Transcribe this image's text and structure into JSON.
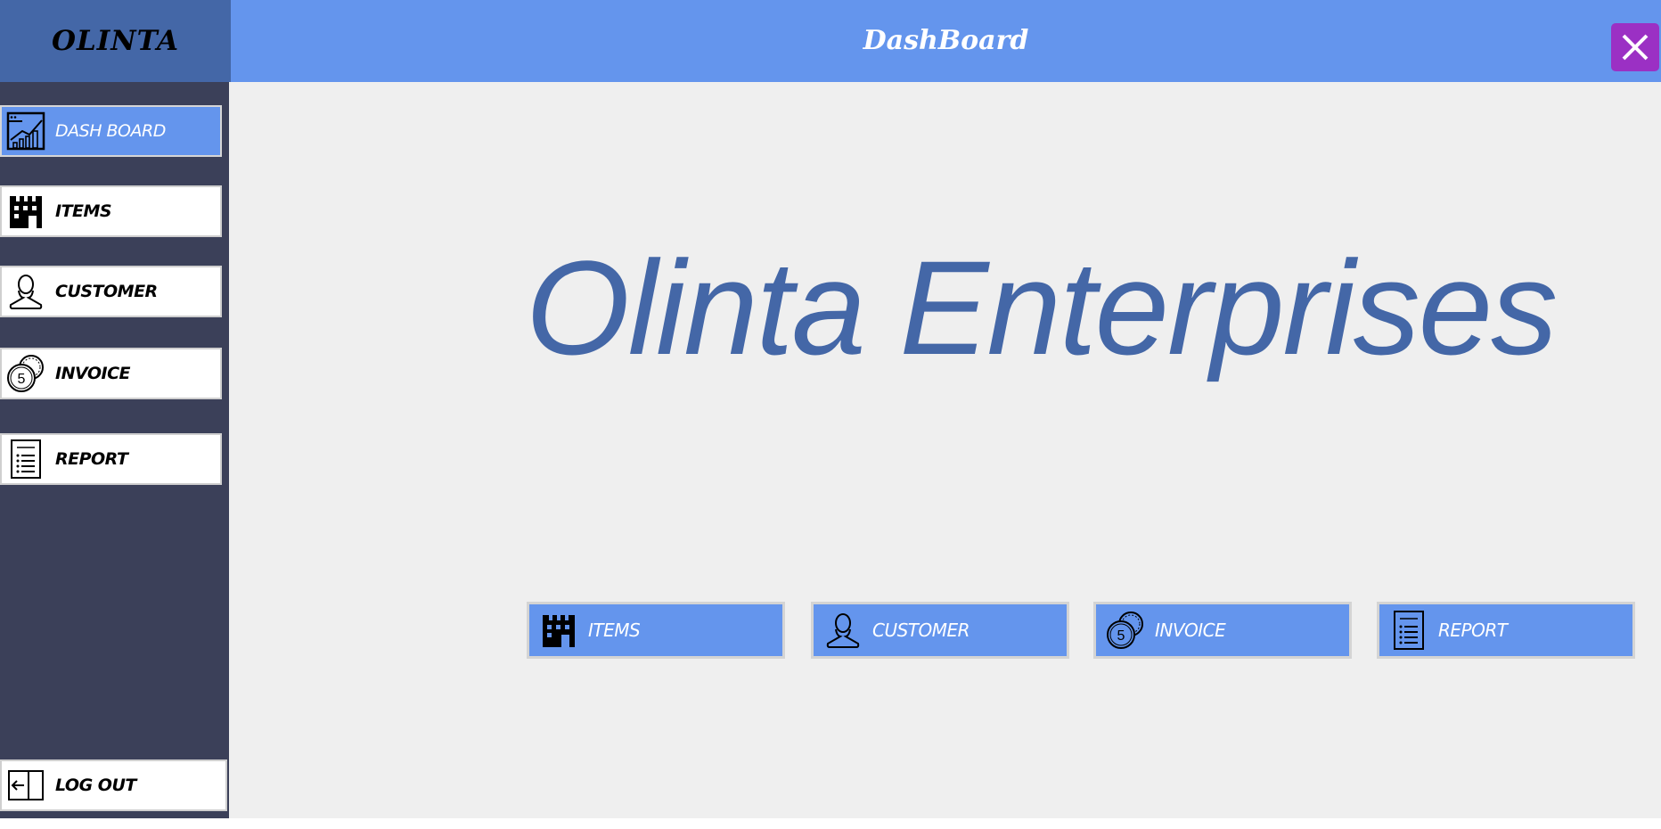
{
  "app": {
    "brand": "OLINTA",
    "title": "DashBoard",
    "close_icon": "close-icon",
    "accent": "#6495ed",
    "dark": "#3b4059",
    "brand_bg": "#4467a7",
    "close_bg": "#9b30c4"
  },
  "sidebar": {
    "items": [
      {
        "label": "DASH BOARD",
        "icon": "dashboard-chart-icon",
        "active": true
      },
      {
        "label": "ITEMS",
        "icon": "store-icon",
        "active": false
      },
      {
        "label": "CUSTOMER",
        "icon": "person-icon",
        "active": false
      },
      {
        "label": "INVOICE",
        "icon": "coins-icon",
        "active": false
      },
      {
        "label": "REPORT",
        "icon": "report-list-icon",
        "active": false
      }
    ],
    "logout": {
      "label": "LOG OUT",
      "icon": "logout-icon"
    }
  },
  "main": {
    "company_name": "Olinta Enterprises",
    "tiles": [
      {
        "label": "ITEMS",
        "icon": "store-icon"
      },
      {
        "label": "CUSTOMER",
        "icon": "person-icon"
      },
      {
        "label": "INVOICE",
        "icon": "coins-icon"
      },
      {
        "label": "REPORT",
        "icon": "report-list-icon"
      }
    ]
  }
}
